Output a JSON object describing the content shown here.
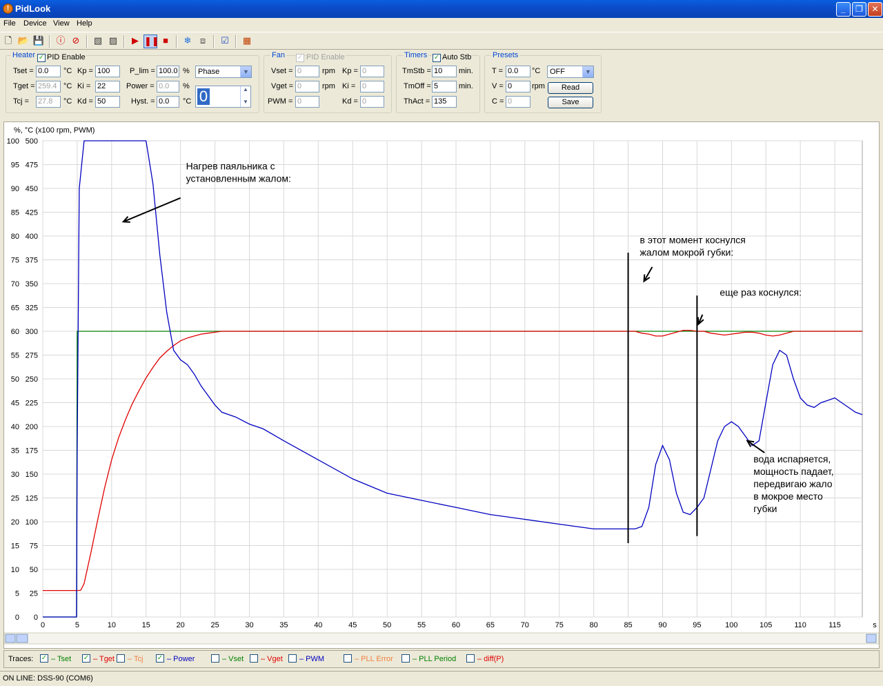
{
  "window": {
    "title": "PidLook"
  },
  "menu": [
    "File",
    "Device",
    "View",
    "Help"
  ],
  "toolbar_icons": [
    "new-icon",
    "open-icon",
    "save-icon",
    "connect-icon",
    "disconnect-icon",
    "chart-export-icon",
    "chart-import-icon",
    "record-icon",
    "pause-icon",
    "stop-icon",
    "freeze-icon",
    "grid-icon",
    "checklist-icon",
    "palette-icon"
  ],
  "heater": {
    "group_label": "Heater",
    "pid_enable_label": "PID Enable",
    "pid_enabled": true,
    "tset_label": "Tset =",
    "tset_value": "0.0",
    "tset_unit": "°C",
    "tget_label": "Tget =",
    "tget_value": "259.4",
    "tget_unit": "°C",
    "tcj_label": "Tcj =",
    "tcj_value": "27.8",
    "tcj_unit": "°C",
    "kp_label": "Kp =",
    "kp_value": "100",
    "ki_label": "Ki =",
    "ki_value": "22",
    "kd_label": "Kd =",
    "kd_value": "50",
    "plim_label": "P_lim =",
    "plim_value": "100.0",
    "plim_unit": "%",
    "power_label": "Power =",
    "power_value": "0.0",
    "power_unit": "%",
    "hyst_label": "Hyst. =",
    "hyst_value": "0.0",
    "hyst_unit": "°C",
    "mode_select": "Phase",
    "spin_value": "0"
  },
  "fan": {
    "group_label": "Fan",
    "pid_enable_label": "PID Enable",
    "vset_label": "Vset =",
    "vset_value": "0",
    "vset_unit": "rpm",
    "vget_label": "Vget =",
    "vget_value": "0",
    "vget_unit": "rpm",
    "pwm_label": "PWM =",
    "pwm_value": "0",
    "kp_label": "Kp =",
    "kp_value": "0",
    "ki_label": "Ki =",
    "ki_value": "0",
    "kd_label": "Kd =",
    "kd_value": "0"
  },
  "timers": {
    "group_label": "Timers",
    "auto_stb_label": "Auto Stb",
    "auto_stb_checked": true,
    "tmstb_label": "TmStb =",
    "tmstb_value": "10",
    "tmstb_unit": "min.",
    "tmoff_label": "TmOff =",
    "tmoff_value": "5",
    "tmoff_unit": "min.",
    "thact_label": "ThAct =",
    "thact_value": "135"
  },
  "presets": {
    "group_label": "Presets",
    "t_label": "T =",
    "t_value": "0.0",
    "t_unit": "°C",
    "v_label": "V =",
    "v_value": "0",
    "v_unit": "rpm",
    "c_label": "C =",
    "c_value": "0",
    "select_value": "OFF",
    "read_label": "Read",
    "save_label": "Save"
  },
  "chart_data": {
    "type": "line",
    "axis_header": "%,   °C  (x100 rpm, PWM)",
    "xlabel": "s",
    "xlim": [
      0,
      119
    ],
    "ylim_percent": [
      0,
      100
    ],
    "ylim_temp": [
      0,
      500
    ],
    "x_ticks": [
      0,
      5,
      10,
      15,
      20,
      25,
      30,
      35,
      40,
      45,
      50,
      55,
      60,
      65,
      70,
      75,
      80,
      85,
      90,
      95,
      100,
      105,
      110,
      115
    ],
    "y_ticks_percent": [
      0,
      5,
      10,
      15,
      20,
      25,
      30,
      35,
      40,
      45,
      50,
      55,
      60,
      65,
      70,
      75,
      80,
      85,
      90,
      95,
      100
    ],
    "y_ticks_temp": [
      0,
      25,
      50,
      75,
      100,
      125,
      150,
      175,
      200,
      225,
      250,
      275,
      300,
      325,
      350,
      375,
      400,
      425,
      450,
      475,
      500
    ],
    "grid": true,
    "colors": {
      "tset": "#008000",
      "tget": "#E00000",
      "power": "#0000C0",
      "annotation": "#000000"
    },
    "series": [
      {
        "name": "Tset",
        "unit": "°C",
        "x": [
          0,
          4.9,
          5,
          119
        ],
        "values": [
          0,
          0,
          300,
          300
        ]
      },
      {
        "name": "Tget",
        "unit": "°C",
        "x": [
          0,
          5,
          5.5,
          6,
          7,
          8,
          9,
          10,
          11,
          12,
          13,
          14,
          15,
          16,
          17,
          18,
          19,
          20,
          21,
          22,
          23,
          24,
          25,
          26,
          30,
          40,
          50,
          60,
          70,
          80,
          85,
          86,
          87,
          88,
          89,
          90,
          91,
          92,
          93,
          94,
          95,
          96,
          97,
          98,
          99,
          100,
          101,
          102,
          103,
          104,
          105,
          106,
          107,
          108,
          109,
          110,
          119
        ],
        "values": [
          27.8,
          27.8,
          28,
          35,
          68,
          103,
          136,
          165,
          188,
          207,
          224,
          238,
          251,
          262,
          272,
          279,
          285,
          290,
          293,
          295,
          297,
          298,
          299,
          300,
          300,
          300,
          300,
          300,
          300,
          300,
          300,
          300,
          298,
          297,
          295,
          295,
          297,
          299,
          301,
          301,
          300,
          300,
          298,
          297,
          296,
          297,
          298,
          299,
          299,
          298,
          296,
          295,
          296,
          298,
          300,
          300,
          300
        ]
      },
      {
        "name": "Power",
        "unit": "%",
        "x": [
          0,
          4.9,
          5,
          5.3,
          6,
          10,
          15,
          16,
          17,
          18,
          19,
          20,
          21,
          22,
          23,
          24,
          25,
          26,
          28,
          30,
          32,
          35,
          40,
          45,
          50,
          55,
          60,
          65,
          70,
          75,
          80,
          85,
          86,
          87,
          88,
          89,
          90,
          91,
          92,
          93,
          94,
          95,
          96,
          97,
          98,
          99,
          100,
          101,
          102,
          103,
          104,
          105,
          106,
          107,
          108,
          109,
          110,
          111,
          112,
          113,
          114,
          115,
          116,
          117,
          118,
          119
        ],
        "values": [
          0,
          0,
          35,
          90,
          100,
          100,
          100,
          91,
          76,
          64,
          56,
          54,
          53,
          51,
          48.5,
          46.5,
          44.5,
          43,
          42,
          40.5,
          39.5,
          37,
          33,
          29,
          26,
          24.5,
          23,
          21.5,
          20.5,
          19.5,
          18.5,
          18.5,
          18.5,
          19,
          23,
          32,
          36,
          33,
          26,
          22,
          21.5,
          23,
          25,
          31,
          37,
          40,
          41,
          40,
          38,
          36,
          37,
          45,
          53,
          56,
          55,
          50,
          46,
          44.5,
          44,
          45,
          45.5,
          46,
          45,
          44,
          43,
          42.5
        ]
      }
    ],
    "annotations": [
      {
        "text": [
          "Нагрев паяльника с",
          "установленным жалом:"
        ],
        "text_x": 20.8,
        "text_y": 94,
        "arrow_from_x": 20,
        "arrow_from_y": 88,
        "arrow_to_x": 11.7,
        "arrow_to_y": 83
      },
      {
        "text": [
          "в этот момент коснулся",
          "жалом мокрой губки:"
        ],
        "text_x": 86.7,
        "text_y": 78.5,
        "arrow_from_x": 88.5,
        "arrow_from_y": 73.5,
        "arrow_to_x": 87.3,
        "arrow_to_y": 70.5
      },
      {
        "text": [
          "еще раз коснулся:"
        ],
        "text_x": 98.3,
        "text_y": 67.5,
        "arrow_from_x": 95.8,
        "arrow_from_y": 63.5,
        "arrow_to_x": 95.2,
        "arrow_to_y": 61.5
      },
      {
        "text": [
          "вода испаряется,",
          "мощность падает,",
          "передвигаю жало",
          "в мокрое место",
          "губки"
        ],
        "text_x": 103.2,
        "text_y": 32.5,
        "arrow_from_x": 104.8,
        "arrow_from_y": 34.5,
        "arrow_to_x": 102.3,
        "arrow_to_y": 37
      }
    ],
    "marker_lines": [
      {
        "x": 85,
        "y_from": 15.5,
        "y_to": 76.5
      },
      {
        "x": 95,
        "y_from": 17,
        "y_to": 67.5
      }
    ]
  },
  "traces": {
    "label": "Traces:",
    "items": [
      {
        "label": "– Tset",
        "checked": true,
        "color": "#008000"
      },
      {
        "label": "– Tget",
        "checked": true,
        "color": "#E00000"
      },
      {
        "label": "– Tcj",
        "checked": false,
        "color": "#F08040"
      },
      {
        "label": "– Power",
        "checked": true,
        "color": "#0000C0"
      },
      {
        "label": "– Vset",
        "checked": false,
        "color": "#008000"
      },
      {
        "label": "– Vget",
        "checked": false,
        "color": "#E00000"
      },
      {
        "label": "– PWM",
        "checked": false,
        "color": "#0000C0"
      },
      {
        "label": "– PLL Error",
        "checked": false,
        "color": "#F08040"
      },
      {
        "label": "– PLL Period",
        "checked": false,
        "color": "#008000"
      },
      {
        "label": "– diff(P)",
        "checked": false,
        "color": "#E00000"
      }
    ]
  },
  "status": {
    "text": "ON LINE: DSS-90 (COM6)"
  }
}
